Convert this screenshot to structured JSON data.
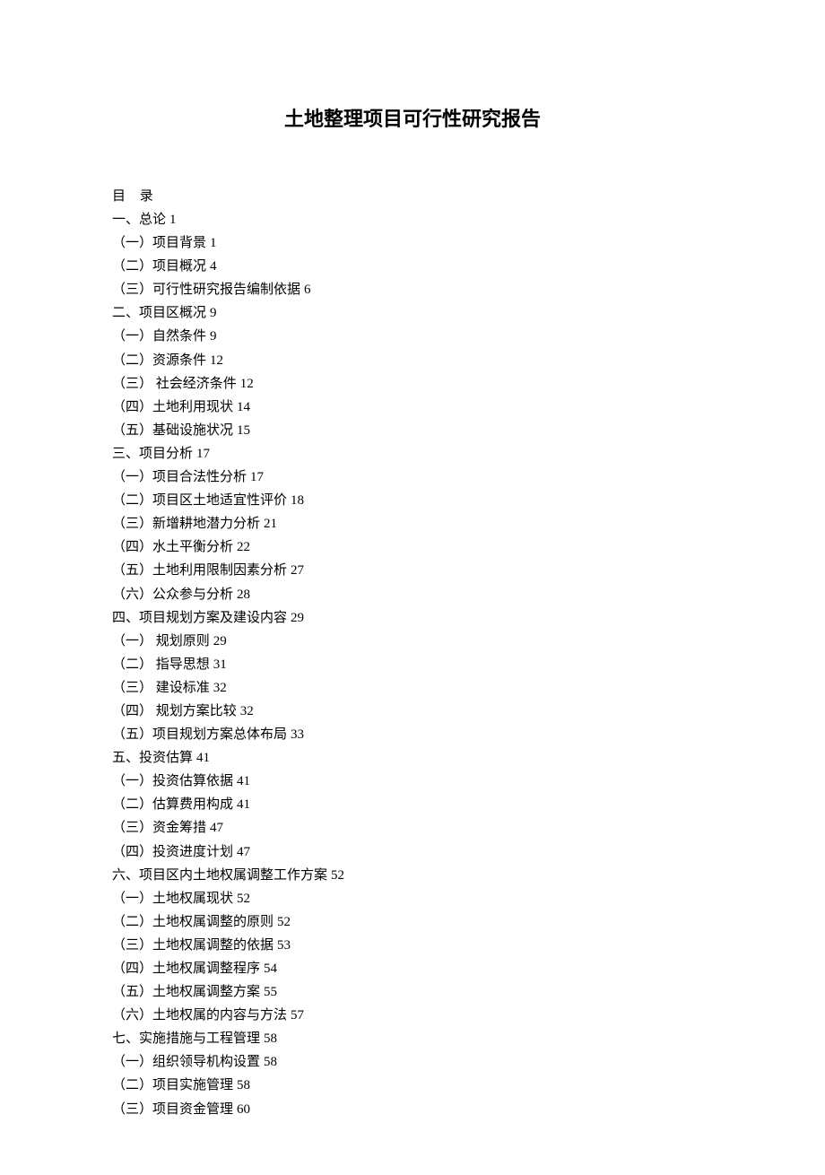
{
  "title": "土地整理项目可行性研究报告",
  "toc_header": "目 录",
  "toc": [
    {
      "label": "一、总论",
      "page": "1",
      "level": 0
    },
    {
      "label": "（一）项目背景",
      "page": "1",
      "level": 1
    },
    {
      "label": "（二）项目概况",
      "page": "4",
      "level": 1
    },
    {
      "label": "（三）可行性研究报告编制依据",
      "page": "6",
      "level": 1
    },
    {
      "label": "二、项目区概况",
      "page": "9",
      "level": 0
    },
    {
      "label": "（一）自然条件",
      "page": "9",
      "level": 1
    },
    {
      "label": "（二）资源条件",
      "page": "12",
      "level": 1
    },
    {
      "label": "（三） 社会经济条件",
      "page": "12",
      "level": 1
    },
    {
      "label": "（四）土地利用现状",
      "page": "14",
      "level": 1
    },
    {
      "label": "（五）基础设施状况",
      "page": "15",
      "level": 1
    },
    {
      "label": "三、项目分析",
      "page": "17",
      "level": 0
    },
    {
      "label": "（一）项目合法性分析",
      "page": "17",
      "level": 1
    },
    {
      "label": "（二）项目区土地适宜性评价",
      "page": "18",
      "level": 1
    },
    {
      "label": "（三）新增耕地潜力分析",
      "page": "21",
      "level": 1
    },
    {
      "label": "（四）水土平衡分析",
      "page": "22",
      "level": 1
    },
    {
      "label": "（五）土地利用限制因素分析",
      "page": "27",
      "level": 1
    },
    {
      "label": "（六）公众参与分析",
      "page": "28",
      "level": 1
    },
    {
      "label": "四、项目规划方案及建设内容",
      "page": "29",
      "level": 0
    },
    {
      "label": "（一） 规划原则",
      "page": "29",
      "level": 1
    },
    {
      "label": "（二） 指导思想",
      "page": "31",
      "level": 1
    },
    {
      "label": "（三） 建设标准",
      "page": "32",
      "level": 1
    },
    {
      "label": "（四） 规划方案比较",
      "page": "32",
      "level": 1
    },
    {
      "label": "（五）项目规划方案总体布局",
      "page": "33",
      "level": 1
    },
    {
      "label": "五、投资估算",
      "page": "41",
      "level": 0
    },
    {
      "label": "（一）投资估算依据",
      "page": "41",
      "level": 1
    },
    {
      "label": "（二）估算费用构成",
      "page": "41",
      "level": 1
    },
    {
      "label": "（三）资金筹措",
      "page": "47",
      "level": 1
    },
    {
      "label": "（四）投资进度计划",
      "page": "47",
      "level": 1
    },
    {
      "label": "六、项目区内土地权属调整工作方案",
      "page": "52",
      "level": 0
    },
    {
      "label": "（一）土地权属现状",
      "page": "52",
      "level": 1
    },
    {
      "label": "（二）土地权属调整的原则",
      "page": "52",
      "level": 1
    },
    {
      "label": "（三）土地权属调整的依据",
      "page": "53",
      "level": 1
    },
    {
      "label": "（四）土地权属调整程序",
      "page": "54",
      "level": 1
    },
    {
      "label": "（五）土地权属调整方案",
      "page": "55",
      "level": 1
    },
    {
      "label": "（六）土地权属的内容与方法",
      "page": "57",
      "level": 1
    },
    {
      "label": "七、实施措施与工程管理",
      "page": "58",
      "level": 0
    },
    {
      "label": "（一）组织领导机构设置",
      "page": "58",
      "level": 1
    },
    {
      "label": "（二）项目实施管理",
      "page": "58",
      "level": 1
    },
    {
      "label": "（三）项目资金管理",
      "page": "60",
      "level": 1
    }
  ]
}
